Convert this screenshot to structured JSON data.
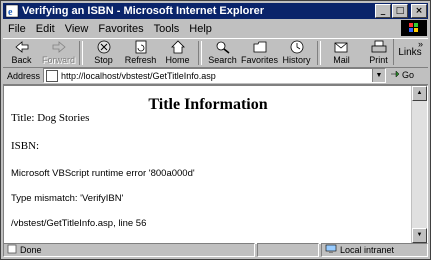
{
  "window": {
    "title": "Verifying an ISBN - Microsoft Internet Explorer",
    "buttons": {
      "minimize": "_",
      "maximize": "□",
      "close": "×"
    }
  },
  "menu": {
    "items": [
      {
        "label": "File"
      },
      {
        "label": "Edit"
      },
      {
        "label": "View"
      },
      {
        "label": "Favorites"
      },
      {
        "label": "Tools"
      },
      {
        "label": "Help"
      }
    ]
  },
  "toolbar": {
    "buttons": [
      {
        "label": "Back",
        "icon": "back-arrow-icon",
        "enabled": true
      },
      {
        "label": "Forward",
        "icon": "forward-arrow-icon",
        "enabled": false
      },
      {
        "label": "Stop",
        "icon": "stop-icon",
        "enabled": true
      },
      {
        "label": "Refresh",
        "icon": "refresh-icon",
        "enabled": true
      },
      {
        "label": "Home",
        "icon": "home-icon",
        "enabled": true
      },
      {
        "label": "Search",
        "icon": "search-icon",
        "enabled": true
      },
      {
        "label": "Favorites",
        "icon": "favorites-icon",
        "enabled": true
      },
      {
        "label": "History",
        "icon": "history-icon",
        "enabled": true
      },
      {
        "label": "Mail",
        "icon": "mail-icon",
        "enabled": true
      },
      {
        "label": "Print",
        "icon": "print-icon",
        "enabled": true
      }
    ],
    "links_label": "Links",
    "links_chevron": "»"
  },
  "address": {
    "label": "Address",
    "url": "http://localhost/vbstest/GetTitleInfo.asp",
    "go_label": "Go"
  },
  "page": {
    "heading": "Title Information",
    "title_line": "Title: Dog Stories",
    "isbn_line": "ISBN:",
    "error_line": "Microsoft VBScript runtime error '800a000d'",
    "mismatch_line": "Type mismatch: 'VerifyIBN'",
    "location_line": "/vbstest/GetTitleInfo.asp, line 56"
  },
  "status": {
    "text": "Done",
    "zone": "Local intranet"
  },
  "colors": {
    "titlebar": "#0a246a",
    "chrome": "#c0c0c0"
  }
}
